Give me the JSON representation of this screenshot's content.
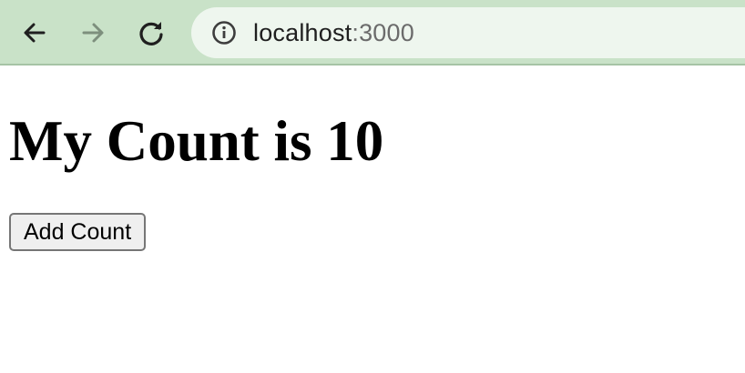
{
  "browser": {
    "url_host": "localhost",
    "url_port": ":3000",
    "icons": {
      "back": "arrow-left-icon",
      "forward": "arrow-right-icon",
      "reload": "reload-icon",
      "site_info": "info-icon"
    },
    "colors": {
      "toolbar": "#c9e2c8",
      "omnibox": "#eef6ee"
    }
  },
  "page": {
    "title": "My Count is 10",
    "add_button_label": "Add Count"
  }
}
